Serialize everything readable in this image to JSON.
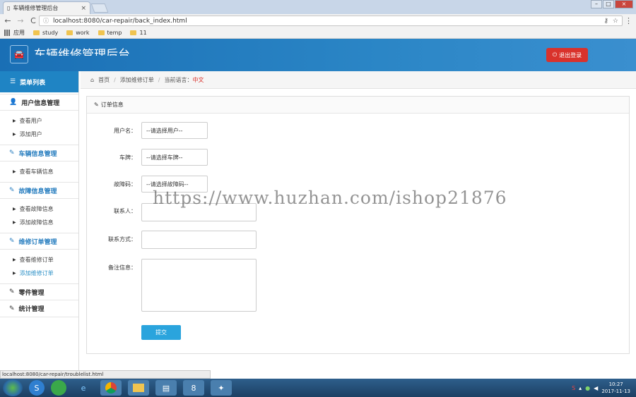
{
  "browser": {
    "tab_title": "车辆维修管理后台",
    "tab_close": "×",
    "url": "localhost:8080/car-repair/back_index.html",
    "back_glyph": "←",
    "forward_glyph": "→",
    "reload_glyph": "C",
    "bookmarks": [
      {
        "label": "应用",
        "icon": "apps-icon"
      },
      {
        "label": "study",
        "icon": "folder-icon"
      },
      {
        "label": "work",
        "icon": "folder-icon"
      },
      {
        "label": "temp",
        "icon": "folder-icon"
      },
      {
        "label": "11",
        "icon": "folder-icon"
      }
    ]
  },
  "header": {
    "title": "车辆维修管理后台",
    "logout_label": "退出登录",
    "logo_icon": "car-icon",
    "accent_color": "#1f84c4",
    "logout_color": "#d9322c"
  },
  "sidebar": {
    "heading": "菜单列表",
    "groups": [
      {
        "label": "用户信息管理",
        "icon": "user-icon",
        "items": [
          "查看用户",
          "添加用户"
        ]
      },
      {
        "label": "车辆信息管理",
        "icon": "edit-icon",
        "items": [
          "查看车辆信息"
        ]
      },
      {
        "label": "故障信息管理",
        "icon": "edit-icon",
        "items": [
          "查看故障信息",
          "添加故障信息"
        ]
      },
      {
        "label": "维修订单管理",
        "icon": "edit-icon",
        "items": [
          "查看维修订单",
          "添加维修订单"
        ]
      },
      {
        "label": "零件管理",
        "icon": "edit-icon",
        "items": []
      },
      {
        "label": "统计管理",
        "icon": "edit-icon",
        "items": []
      }
    ]
  },
  "breadcrumb": {
    "home": "首页",
    "current": "添加维修订单",
    "lang_prefix": "当前语言：",
    "lang_value": "中文"
  },
  "panel": {
    "title": "订单信息"
  },
  "form": {
    "username_label": "用户名：",
    "username_value": "--请选择用户--",
    "plate_label": "车牌：",
    "plate_value": "--请选择车牌--",
    "fault_label": "故障码：",
    "fault_value": "--请选择故障码--",
    "contact_label": "联系人：",
    "phone_label": "联系方式：",
    "note_label": "备注信息：",
    "submit_label": "提交"
  },
  "watermark": "https://www.huzhan.com/ishop21876",
  "status_url": "localhost:8080/car-repair/troublelist.html",
  "taskbar": {
    "time": "10:27",
    "date": "2017-11-13"
  }
}
